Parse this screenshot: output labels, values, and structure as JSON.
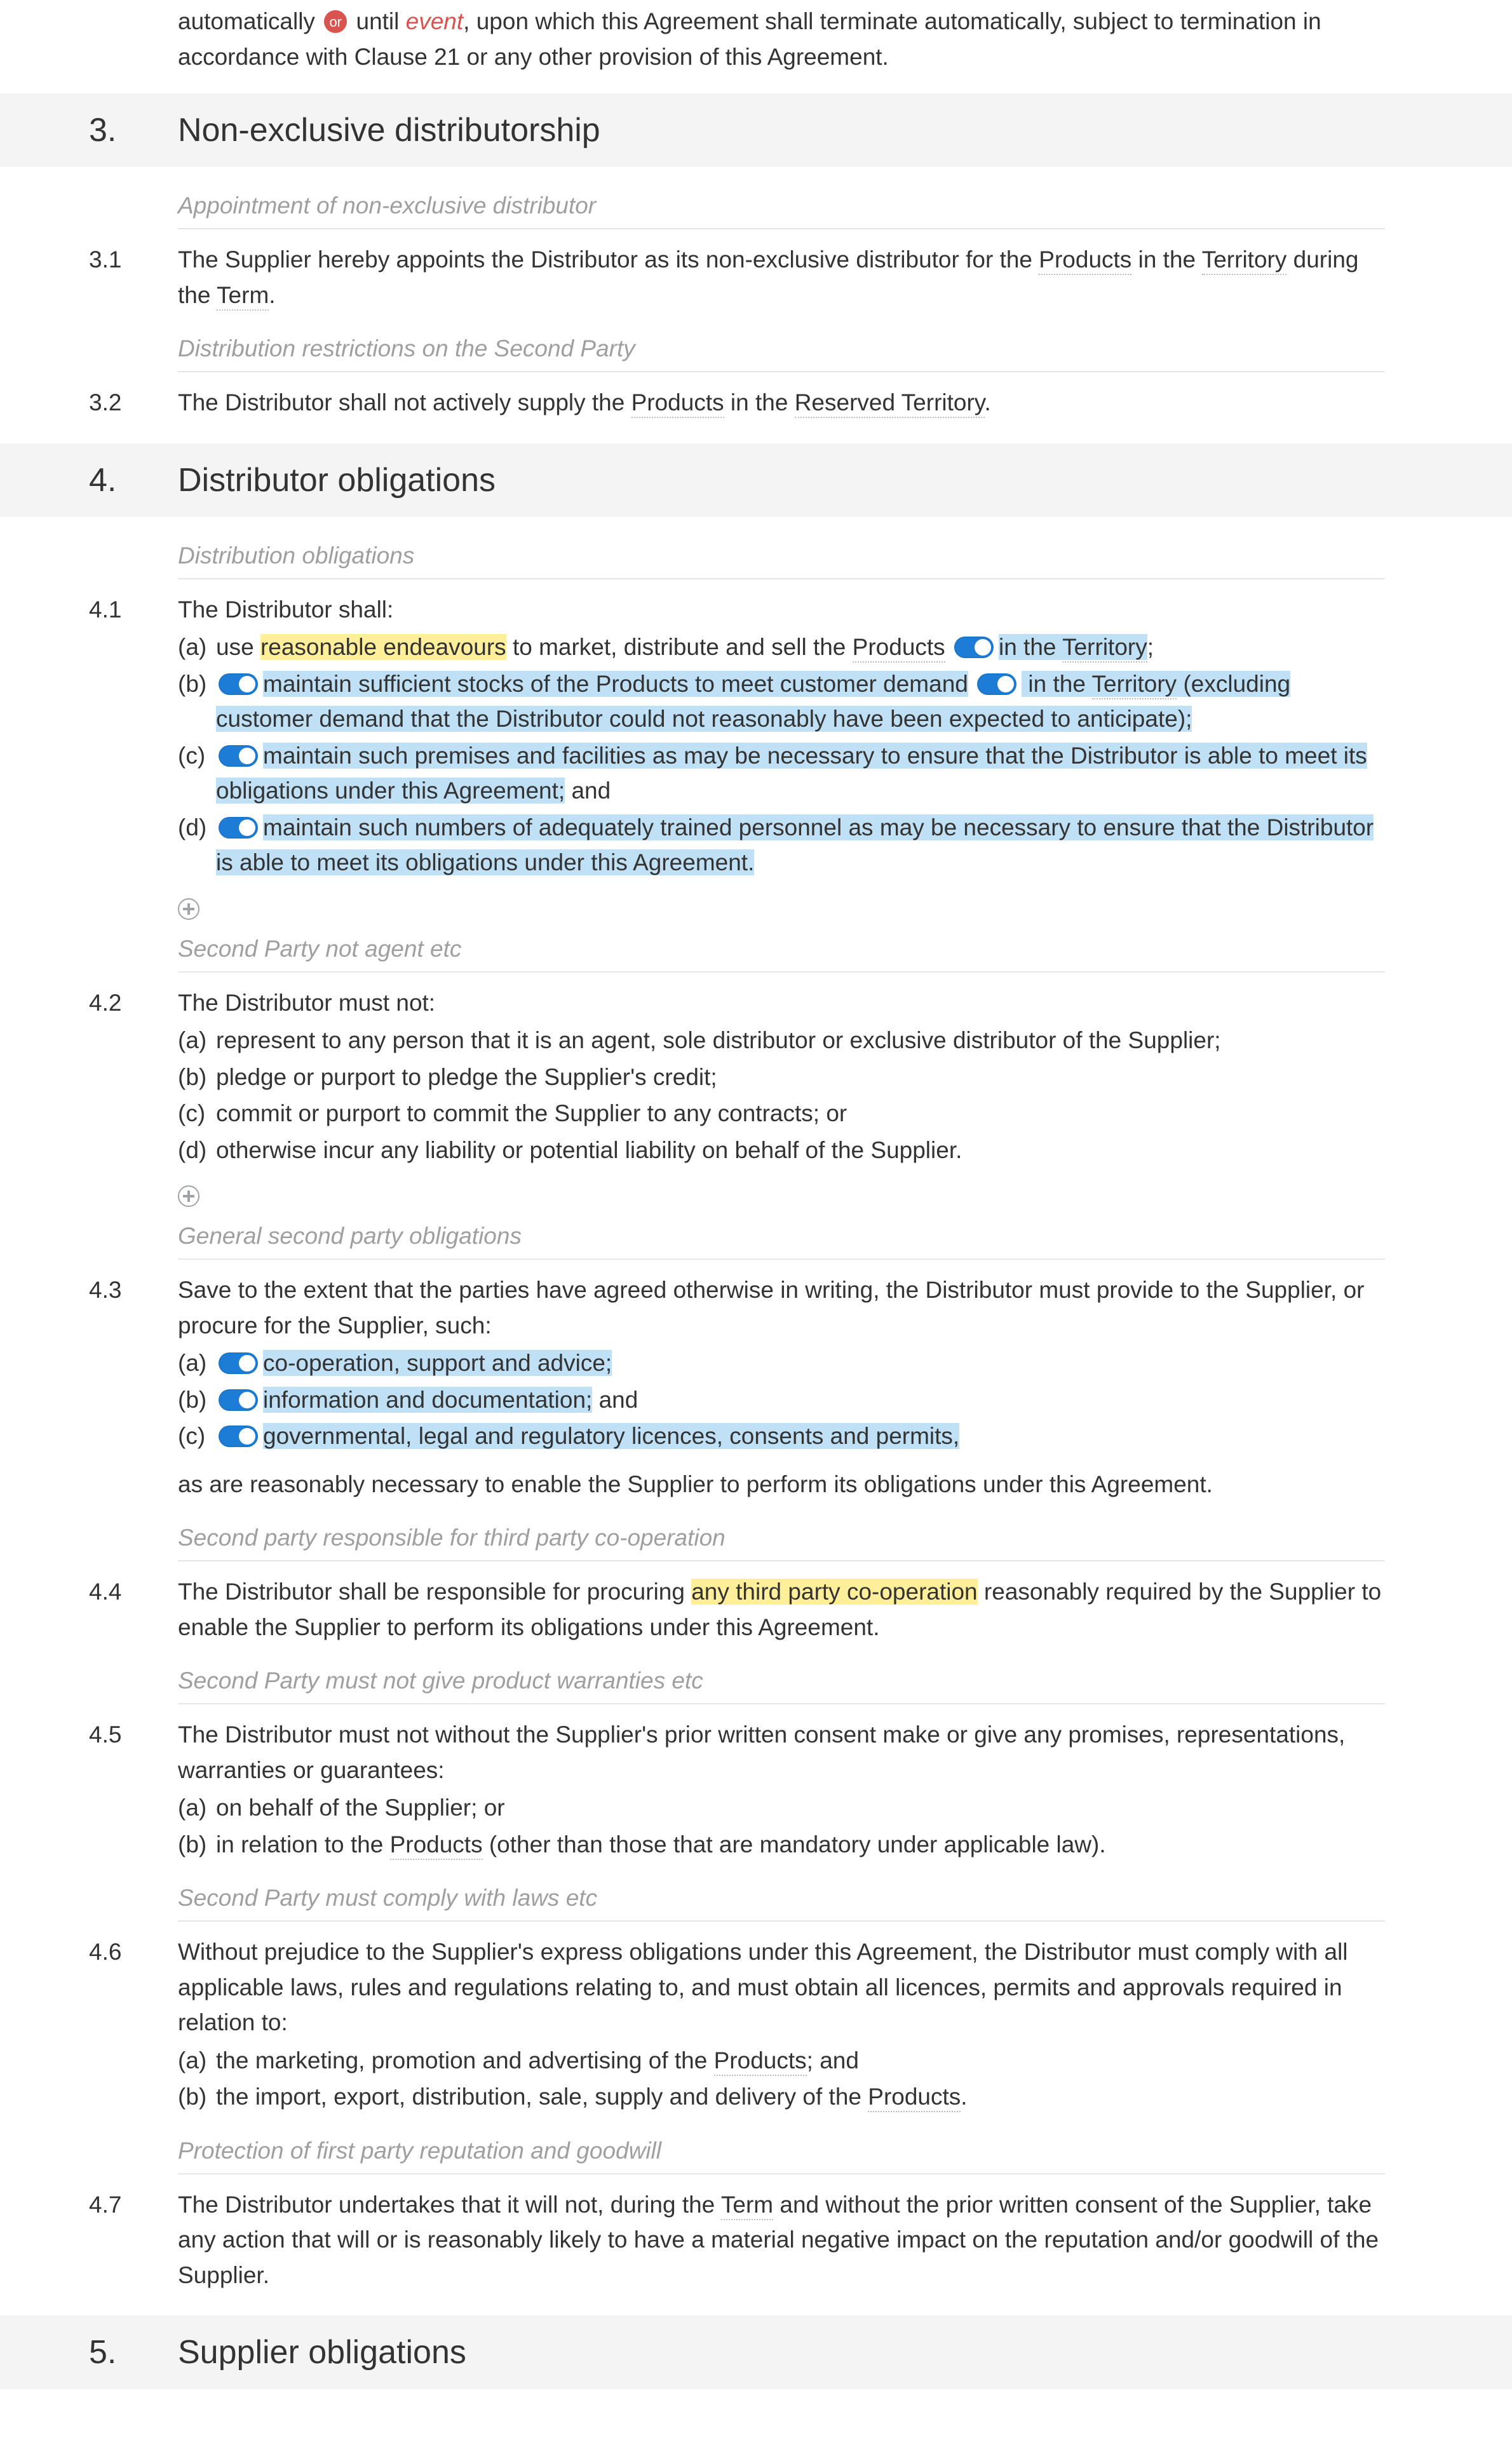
{
  "intro_fragment": {
    "pre": "automatically ",
    "or_label": "or",
    "post_or": " until ",
    "event": "event",
    "after_event": ", upon which this Agreement shall terminate automatically, subject to termination in accordance with Clause 21 or any other provision of this Agreement."
  },
  "sections": {
    "s3": {
      "number": "3.",
      "title": "Non-exclusive distributorship",
      "subhead_1": "Appointment of non-exclusive distributor",
      "clause_3_1": {
        "num": "3.1",
        "pre": "The Supplier hereby appoints the Distributor as its non-exclusive distributor for the ",
        "term_products": "Products",
        "mid1": " in the ",
        "term_territory": "Territory",
        "mid2": " during the ",
        "term_term": "Term",
        "post": "."
      },
      "subhead_2": "Distribution restrictions on the Second Party",
      "clause_3_2": {
        "num": "3.2",
        "pre": "The Distributor shall not actively supply the ",
        "term_products": "Products",
        "mid": " in the ",
        "term_reserved_territory": "Reserved Territory",
        "post": "."
      }
    },
    "s4": {
      "number": "4.",
      "title": "Distributor obligations",
      "subhead_1": "Distribution obligations",
      "clause_4_1_intro": {
        "num": "4.1",
        "text": "The Distributor shall:"
      },
      "clause_4_1_items": {
        "a": {
          "letter": "(a)",
          "pre": "use ",
          "hl": "reasonable endeavours",
          "mid": " to market, distribute and sell the ",
          "term_products": "Products",
          "sp": " ",
          "hl2": "in the ",
          "hl2_term": "Territory",
          "post": ";"
        },
        "b": {
          "letter": "(b)",
          "hl1": "maintain sufficient stocks of the Products to meet customer demand",
          "sp": " ",
          "hl2": " in the ",
          "hl2_term": "Territory",
          "hl2_tail": " (excluding customer demand that the Distributor could not reasonably have been expected to anticipate);"
        },
        "c": {
          "letter": "(c)",
          "hl": "maintain such premises and facilities as may be necessary to ensure that the Distributor is able to meet its obligations under this Agreement;",
          "post": " and"
        },
        "d": {
          "letter": "(d)",
          "hl": "maintain such numbers of adequately trained personnel as may be necessary to ensure that the Distributor is able to meet its obligations under this Agreement."
        }
      },
      "subhead_2": "Second Party not agent etc",
      "clause_4_2_intro": {
        "num": "4.2",
        "text": "The Distributor must not:"
      },
      "clause_4_2_items": {
        "a": {
          "letter": "(a)",
          "text": "represent to any person that it is an agent, sole distributor or exclusive distributor of the Supplier;"
        },
        "b": {
          "letter": "(b)",
          "text": "pledge or purport to pledge the Supplier's credit;"
        },
        "c": {
          "letter": "(c)",
          "text": "commit or purport to commit the Supplier to any contracts; or"
        },
        "d": {
          "letter": "(d)",
          "text": "otherwise incur any liability or potential liability on behalf of the Supplier."
        }
      },
      "subhead_3": "General second party obligations",
      "clause_4_3_intro": {
        "num": "4.3",
        "text": "Save to the extent that the parties have agreed otherwise in writing, the Distributor must provide to the Supplier, or procure for the Supplier, such:"
      },
      "clause_4_3_items": {
        "a": {
          "letter": "(a)",
          "hl": "co-operation, support and advice;"
        },
        "b": {
          "letter": "(b)",
          "hl": "information and documentation;",
          "post": " and"
        },
        "c": {
          "letter": "(c)",
          "hl": "governmental, legal and regulatory licences, consents and permits,",
          "post": ""
        }
      },
      "clause_4_3_tail": "as are reasonably necessary to enable the Supplier to perform its obligations under this Agreement.",
      "subhead_4": "Second party responsible for third party co-operation",
      "clause_4_4": {
        "num": "4.4",
        "pre": "The Distributor shall be responsible for procuring ",
        "hl": "any third party co-operation",
        "post": " reasonably required by the Supplier to enable the Supplier to perform its obligations under this Agreement."
      },
      "subhead_5": "Second Party must not give product warranties etc",
      "clause_4_5_intro": {
        "num": "4.5",
        "text": "The Distributor must not without the Supplier's prior written consent make or give any promises, representations, warranties or guarantees:"
      },
      "clause_4_5_items": {
        "a": {
          "letter": "(a)",
          "text": "on behalf of the Supplier; or"
        },
        "b": {
          "letter": "(b)",
          "pre": "in relation to the ",
          "term_products": "Products",
          "post": " (other than those that are mandatory under applicable law)."
        }
      },
      "subhead_6": "Second Party must comply with laws etc",
      "clause_4_6_intro": {
        "num": "4.6",
        "text": "Without prejudice to the Supplier's express obligations under this Agreement, the Distributor must comply with all applicable laws, rules and regulations relating to, and must obtain all licences, permits and approvals required in relation to:"
      },
      "clause_4_6_items": {
        "a": {
          "letter": "(a)",
          "pre": "the marketing, promotion and advertising of the ",
          "term_products": "Products",
          "post": "; and"
        },
        "b": {
          "letter": "(b)",
          "pre": "the import, export, distribution, sale, supply and delivery of the ",
          "term_products": "Products",
          "post": "."
        }
      },
      "subhead_7": "Protection of first party reputation and goodwill",
      "clause_4_7": {
        "num": "4.7",
        "pre": "The Distributor undertakes that it will not, during the ",
        "term_term": "Term",
        "post": " and without the prior written consent of the Supplier, take any action that will or is reasonably likely to have a material negative impact on the reputation and/or goodwill of the Supplier."
      }
    },
    "s5": {
      "number": "5.",
      "title": "Supplier obligations"
    }
  }
}
